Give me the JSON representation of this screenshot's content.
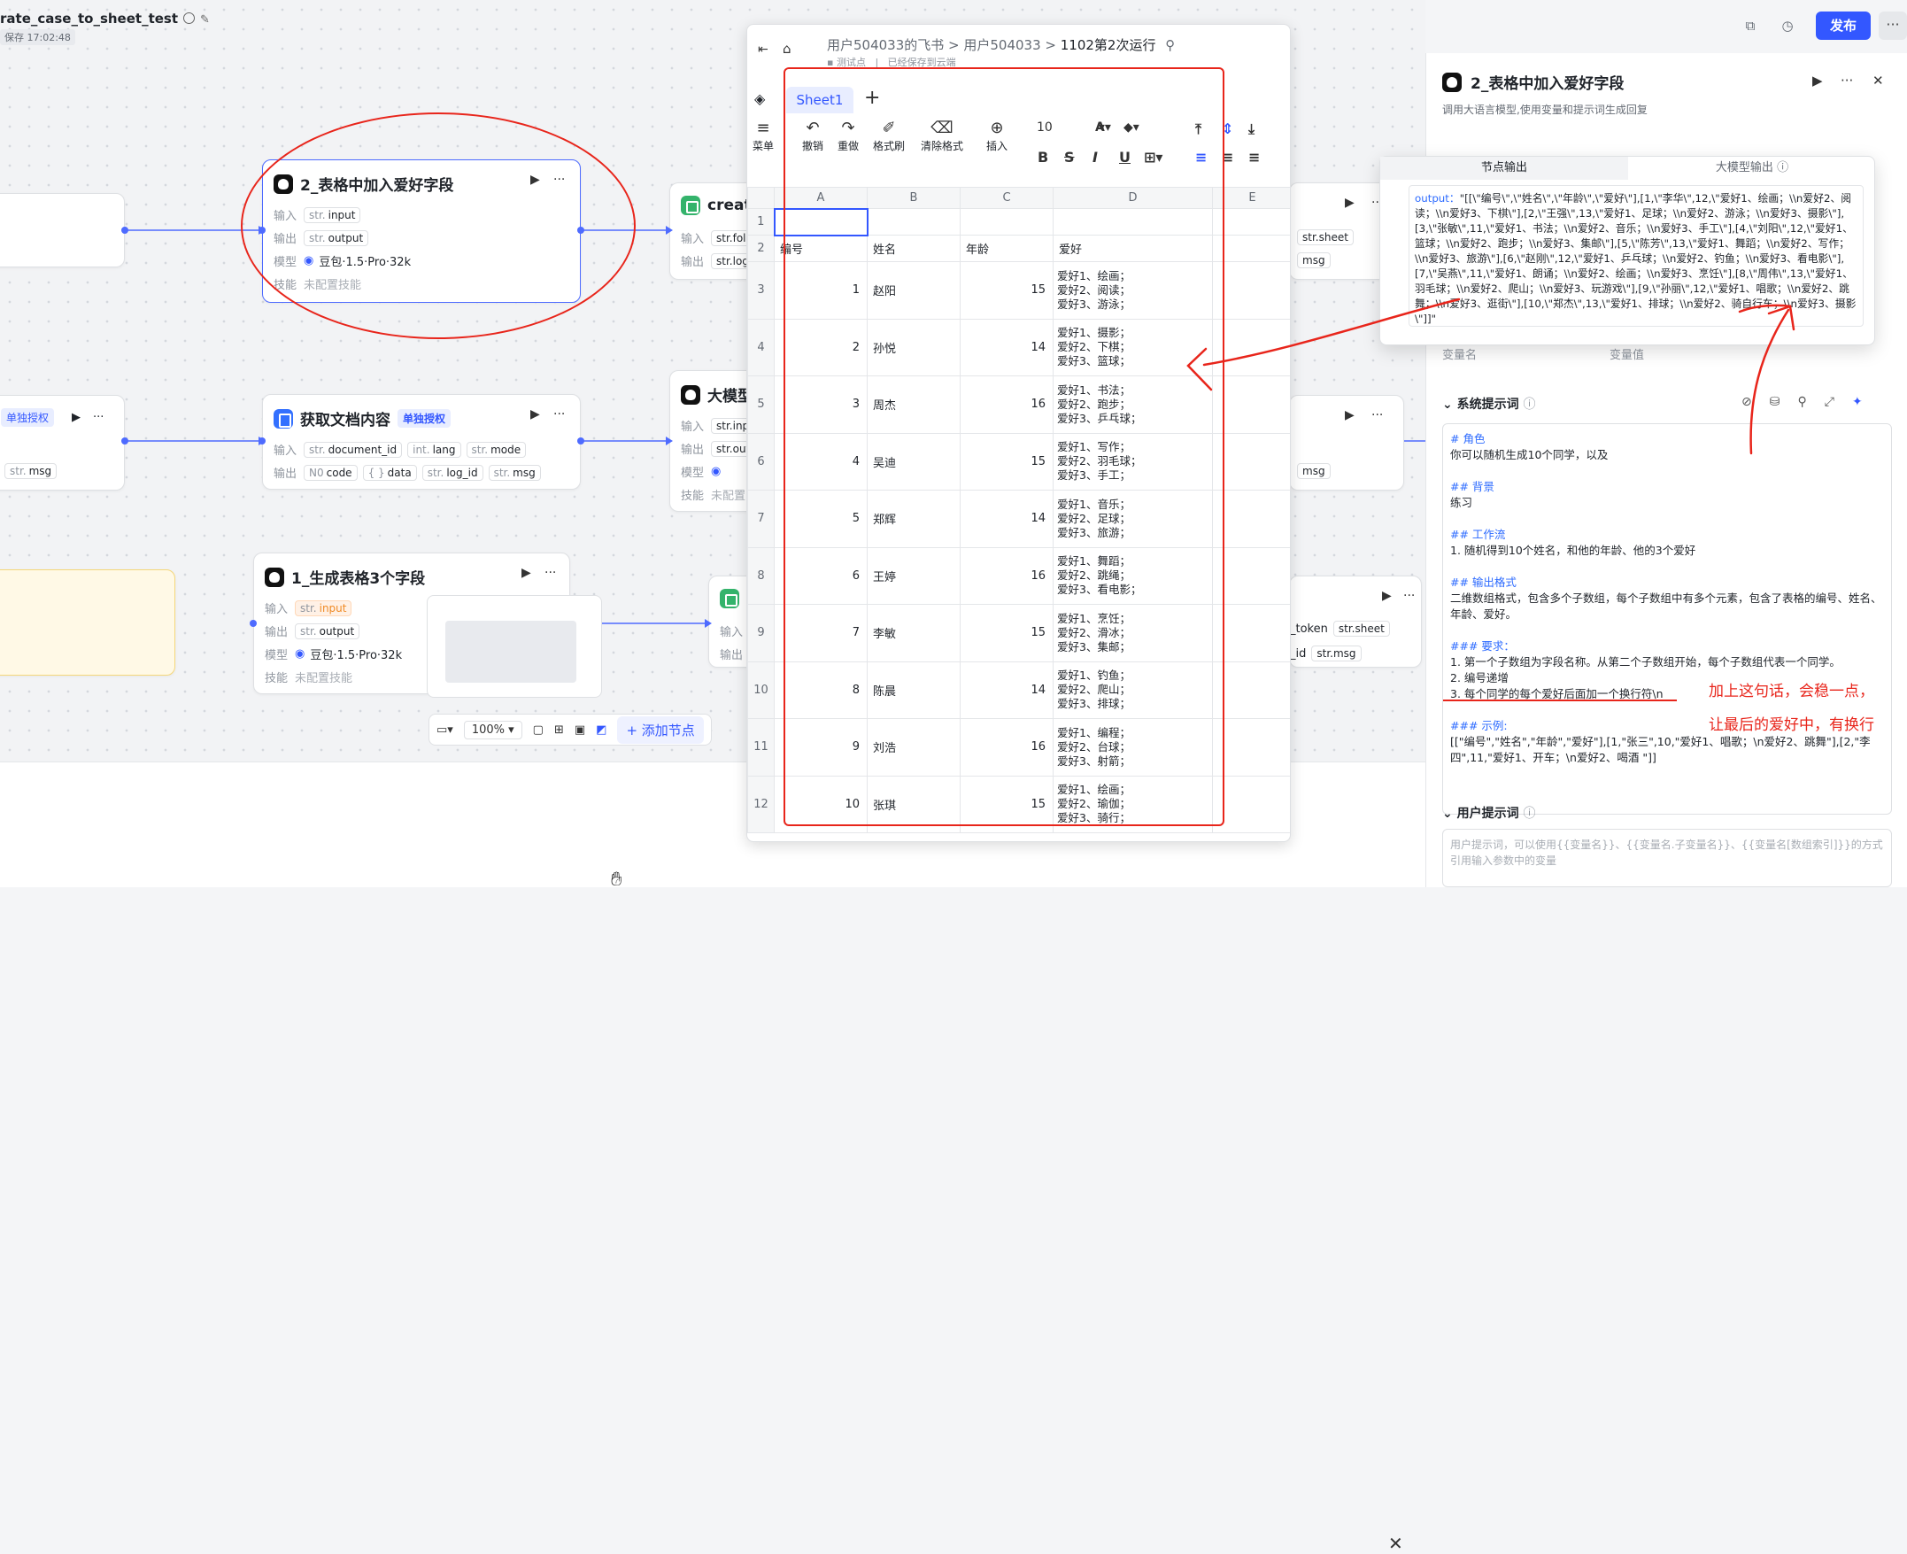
{
  "app": {
    "title": "rate_case_to_sheet_test",
    "saved": "保存 17:02:48",
    "publish": "发布",
    "more": "···"
  },
  "nodes": {
    "n2": {
      "title": "2_表格中加入爱好字段",
      "in_label": "输入",
      "in_type": "str.",
      "in_name": "input",
      "out_label": "输出",
      "out_type": "str.",
      "out_name": "output",
      "model_label": "模型",
      "model": "豆包·1.5·Pro·32k",
      "skill_label": "技能",
      "skill": "未配置技能"
    },
    "create": {
      "title": "create",
      "in_label": "输入",
      "in_frag": "str.fold",
      "out_label": "输出",
      "out_frag": "str.log_"
    },
    "getdoc": {
      "title": "获取文档内容",
      "badge": "单独授权",
      "in_label": "输入",
      "in1": "document_id",
      "in1_t": "str.",
      "in2": "lang",
      "in2_t": "int.",
      "in3": "mode",
      "in3_t": "str.",
      "out_label": "输出",
      "out1": "code",
      "out1_t": "N0",
      "out2": "data",
      "out2_t": "{ }",
      "out3": "log_id",
      "out3_t": "str.",
      "out4": "msg",
      "out4_t": "str."
    },
    "llm_mid": {
      "title": "大模型",
      "in_label": "输入",
      "in_frag": "str.inpu",
      "out_label": "输出",
      "out_frag": "str.outp",
      "model_label": "模型",
      "skill_label": "技能",
      "skill": "未配置"
    },
    "left_mid": {
      "badge": "单独授权",
      "msg": "msg",
      "msg_t": "str."
    },
    "n1": {
      "title": "1_生成表格3个字段",
      "in_label": "输入",
      "in_type": "str.",
      "in_name": "input",
      "out_label": "输出",
      "out_type": "str.",
      "out_name": "output",
      "model_label": "模型",
      "model": "豆包·1.5·Pro·32k",
      "skill_label": "技能",
      "skill": "未配置技能"
    },
    "sheet_bot": {
      "in_label": "输入",
      "out_label": "输出"
    },
    "right_top": {
      "frag": "str.sheet",
      "msg": "msg"
    },
    "right_mid": {
      "msg": "msg"
    },
    "right_bot": {
      "f1": "_token",
      "f2": "str.sheet",
      "f3": "_id",
      "f4": "str.msg"
    }
  },
  "zoom": {
    "value": "100%",
    "add_node": "添加节点"
  },
  "sheet": {
    "breadcrumb1": "用户504033的飞书",
    "breadcrumb2": "用户504033",
    "breadcrumb3": "1102第2次运行",
    "status1": "测试点",
    "status2": "已经保存到云端",
    "tab": "Sheet1",
    "add_tab": "+",
    "toolbar": {
      "menu": "菜单",
      "undo": "撤销",
      "redo": "重做",
      "format_painter": "格式刷",
      "clear_format": "清除格式",
      "insert": "插入",
      "font_size": "10"
    },
    "cell_ref": "A1",
    "columns": [
      "A",
      "B",
      "C",
      "D",
      "E"
    ],
    "header_row": {
      "rn": "2",
      "c1": "编号",
      "c2": "姓名",
      "c3": "年龄",
      "c4": "爱好"
    },
    "rows": [
      {
        "rn": "3",
        "id": "1",
        "name": "赵阳",
        "age": "15",
        "h1": "爱好1、绘画；",
        "h2": "爱好2、阅读；",
        "h3": "爱好3、游泳；"
      },
      {
        "rn": "4",
        "id": "2",
        "name": "孙悦",
        "age": "14",
        "h1": "爱好1、摄影；",
        "h2": "爱好2、下棋；",
        "h3": "爱好3、篮球；"
      },
      {
        "rn": "5",
        "id": "3",
        "name": "周杰",
        "age": "16",
        "h1": "爱好1、书法；",
        "h2": "爱好2、跑步；",
        "h3": "爱好3、乒乓球；"
      },
      {
        "rn": "6",
        "id": "4",
        "name": "吴迪",
        "age": "15",
        "h1": "爱好1、写作；",
        "h2": "爱好2、羽毛球；",
        "h3": "爱好3、手工；"
      },
      {
        "rn": "7",
        "id": "5",
        "name": "郑辉",
        "age": "14",
        "h1": "爱好1、音乐；",
        "h2": "爱好2、足球；",
        "h3": "爱好3、旅游；"
      },
      {
        "rn": "8",
        "id": "6",
        "name": "王婷",
        "age": "16",
        "h1": "爱好1、舞蹈；",
        "h2": "爱好2、跳绳；",
        "h3": "爱好3、看电影；"
      },
      {
        "rn": "9",
        "id": "7",
        "name": "李敏",
        "age": "15",
        "h1": "爱好1、烹饪；",
        "h2": "爱好2、滑冰；",
        "h3": "爱好3、集邮；"
      },
      {
        "rn": "10",
        "id": "8",
        "name": "陈晨",
        "age": "14",
        "h1": "爱好1、钓鱼；",
        "h2": "爱好2、爬山；",
        "h3": "爱好3、排球；"
      },
      {
        "rn": "11",
        "id": "9",
        "name": "刘浩",
        "age": "16",
        "h1": "爱好1、编程；",
        "h2": "爱好2、台球；",
        "h3": "爱好3、射箭；"
      },
      {
        "rn": "12",
        "id": "10",
        "name": "张琪",
        "age": "15",
        "h1": "爱好1、绘画；",
        "h2": "爱好2、瑜伽；",
        "h3": "爱好3、骑行；"
      }
    ]
  },
  "panel": {
    "title": "2_表格中加入爱好字段",
    "desc": "调用大语言模型,使用变量和提示词生成回复",
    "var_name": "变量名",
    "var_value": "变量值",
    "sys_prompt_title": "系统提示词",
    "user_prompt_title": "用户提示词",
    "user_prompt_placeholder": "用户提示词，可以使用{{变量名}}、{{变量名.子变量名}}、{{变量名[数组索引]}}的方式引用输入参数中的变量",
    "prompt": {
      "l1": "# 角色",
      "l2": "你可以随机生成10个同学，以及",
      "l3": "## 背景",
      "l4": "练习",
      "l5": "## 工作流",
      "l6": "1. 随机得到10个姓名，和他的年龄、他的3个爱好",
      "l7": "## 输出格式",
      "l8": "二维数组格式，包含多个子数组，每个子数组中有多个元素，包含了表格的编号、姓名、年龄、爱好。",
      "l9": "### 要求：",
      "l10": "1. 第一个子数组为字段名称。从第二个子数组开始，每个子数组代表一个同学。",
      "l11": "2. 编号递增",
      "l12": "3. 每个同学的每个爱好后面加一个换行符\\n",
      "l13": "### 示例:",
      "l14": "[[\"编号\",\"姓名\",\"年龄\",\"爱好\"],[1,\"张三\",10,\"爱好1、唱歌；\\n爱好2、跳舞\"],[2,\"李四\",11,\"爱好1、开车；\\n爱好2、喝酒 \"]]"
    }
  },
  "popup": {
    "tab1": "节点输出",
    "tab2": "大模型输出",
    "key": "output：",
    "text": "\"[[\\\"编号\\\",\\\"姓名\\\",\\\"年龄\\\",\\\"爱好\\\"],[1,\\\"李华\\\",12,\\\"爱好1、绘画；\\\\n爱好2、阅读；\\\\n爱好3、下棋\\\"],[2,\\\"王强\\\",13,\\\"爱好1、足球；\\\\n爱好2、游泳；\\\\n爱好3、摄影\\\"],[3,\\\"张敏\\\",11,\\\"爱好1、书法；\\\\n爱好2、音乐；\\\\n爱好3、手工\\\"],[4,\\\"刘阳\\\",12,\\\"爱好1、篮球；\\\\n爱好2、跑步；\\\\n爱好3、集邮\\\"],[5,\\\"陈芳\\\",13,\\\"爱好1、舞蹈；\\\\n爱好2、写作；\\\\n爱好3、旅游\\\"],[6,\\\"赵刚\\\",12,\\\"爱好1、乒乓球；\\\\n爱好2、钓鱼；\\\\n爱好3、看电影\\\"],[7,\\\"吴燕\\\",11,\\\"爱好1、朗诵；\\\\n爱好2、绘画；\\\\n爱好3、烹饪\\\"],[8,\\\"周伟\\\",13,\\\"爱好1、羽毛球；\\\\n爱好2、爬山；\\\\n爱好3、玩游戏\\\"],[9,\\\"孙丽\\\",12,\\\"爱好1、唱歌；\\\\n爱好2、跳舞；\\\\n爱好3、逛街\\\"],[10,\\\"郑杰\\\",13,\\\"爱好1、排球；\\\\n爱好2、骑自行车；\\\\n爱好3、摄影\\\"]]\""
  },
  "annotation": {
    "line1": "加上这句话，会稳一点，",
    "line2": "让最后的爱好中，有换行"
  },
  "colors": {
    "accent": "#3357ff",
    "annotation": "#e8251b"
  }
}
